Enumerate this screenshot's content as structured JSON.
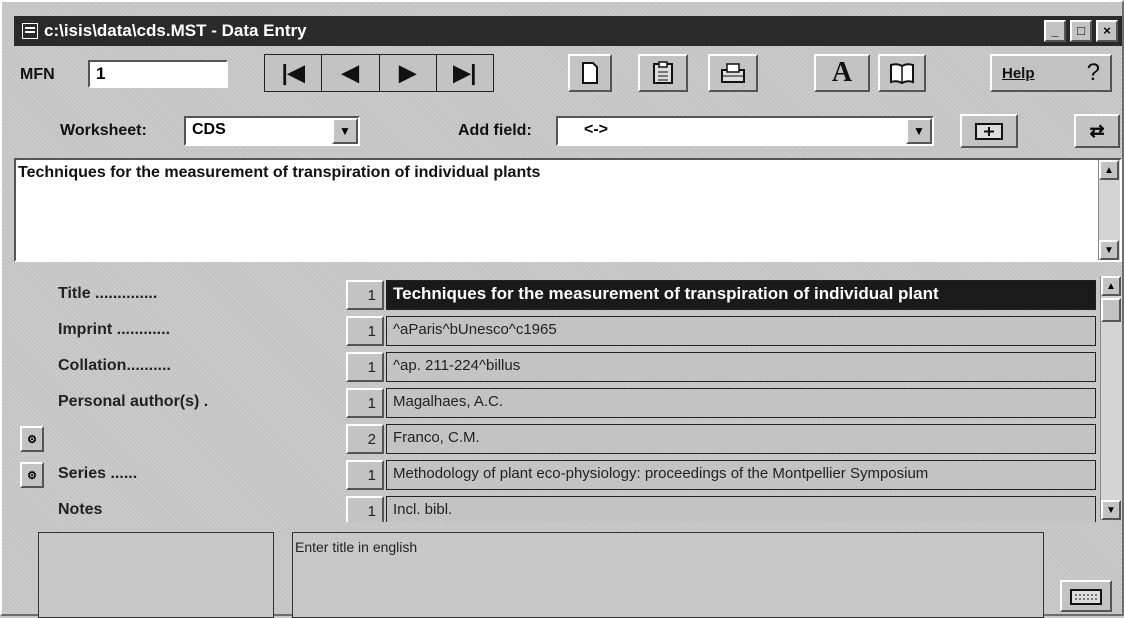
{
  "window": {
    "title": "c:\\isis\\data\\cds.MST - Data Entry",
    "controls": {
      "minimize": "_",
      "maximize": "□",
      "close": "×"
    }
  },
  "toolbar": {
    "mfn_label": "MFN",
    "mfn_value": "1",
    "nav_first": "|◀",
    "nav_prev": "◀",
    "nav_next": "▶",
    "nav_last": "▶|",
    "new_record_icon": "document-icon",
    "copy_icon": "clipboard-icon",
    "save_icon": "save-tray-icon",
    "font_label": "A",
    "dictionary_icon": "book-icon",
    "help_label": "Help",
    "help_question": "?"
  },
  "worksheet": {
    "label": "Worksheet:",
    "value": "CDS",
    "add_field_label": "Add field:",
    "add_field_value": "<->"
  },
  "editor": {
    "text": "Techniques for the measurement of transpiration of individual plants"
  },
  "fields": [
    {
      "label": "Title ..............",
      "occ": "1",
      "value": "Techniques for the measurement of transpiration of individual plant",
      "selected": true,
      "occ_button": false
    },
    {
      "label": "Imprint ............",
      "occ": "1",
      "value": "^aParis^bUnesco^c1965",
      "selected": false,
      "occ_button": false
    },
    {
      "label": "Collation..........",
      "occ": "1",
      "value": "^ap. 211-224^billus",
      "selected": false,
      "occ_button": false
    },
    {
      "label": "Personal author(s) .",
      "occ": "1",
      "value": "Magalhaes, A.C.",
      "selected": false,
      "occ_button": false
    },
    {
      "label": "",
      "occ": "2",
      "value": "Franco, C.M.",
      "selected": false,
      "occ_button": true
    },
    {
      "label": "Series ......",
      "occ": "1",
      "value": "Methodology of plant eco-physiology: proceedings of the Montpellier Symposium",
      "selected": false,
      "occ_button": true
    },
    {
      "label": "Notes",
      "occ": "1",
      "value": "Incl. bibl.",
      "selected": false,
      "occ_button": false
    }
  ],
  "status": {
    "hint": "Enter title in english",
    "left_panel": ""
  }
}
